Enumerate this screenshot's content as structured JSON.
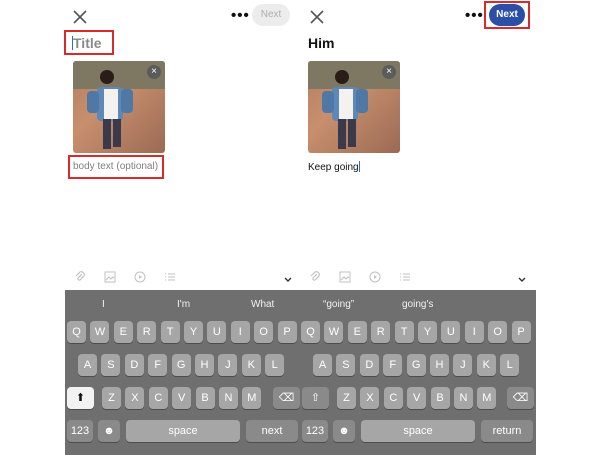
{
  "left": {
    "next_label": "Next",
    "title_placeholder": "Title",
    "body_placeholder": "body text (optional)"
  },
  "right": {
    "next_label": "Next",
    "title_value": "Him",
    "body_value": "Keep going"
  },
  "keyboard": {
    "suggestions_left": [
      "I",
      "I'm",
      "What"
    ],
    "suggestions_right": [
      "“going”",
      "going's"
    ],
    "row1": [
      "Q",
      "W",
      "E",
      "R",
      "T",
      "Y",
      "U",
      "I",
      "O",
      "P"
    ],
    "row2": [
      "A",
      "S",
      "D",
      "F",
      "G",
      "H",
      "J",
      "K",
      "L"
    ],
    "row3": [
      "Z",
      "X",
      "C",
      "V",
      "B",
      "N",
      "M"
    ],
    "numbers_label": "123",
    "space_label": "space",
    "next_label": "next",
    "return_label": "return"
  },
  "colors": {
    "accent": "#2b4ea6",
    "highlight": "#d92b2b"
  }
}
